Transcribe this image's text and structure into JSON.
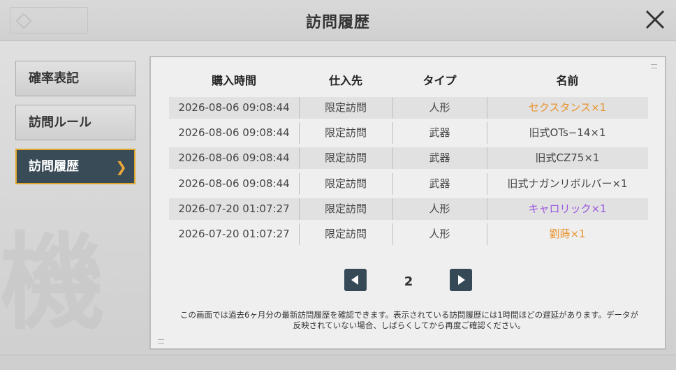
{
  "header": {
    "title": "訪問履歴"
  },
  "sidebar": {
    "items": [
      {
        "label": "確率表記"
      },
      {
        "label": "訪問ルール"
      },
      {
        "label": "訪問履歴"
      }
    ]
  },
  "table": {
    "headers": [
      "購入時間",
      "仕入先",
      "タイプ",
      "名前"
    ],
    "rows": [
      {
        "time": "2026-08-06 09:08:44",
        "source": "限定訪問",
        "type": "人形",
        "name": "セクスタンス×1",
        "color": "#e8932e"
      },
      {
        "time": "2026-08-06 09:08:44",
        "source": "限定訪問",
        "type": "武器",
        "name": "旧式OTs−14×1",
        "color": "#444444"
      },
      {
        "time": "2026-08-06 09:08:44",
        "source": "限定訪問",
        "type": "武器",
        "name": "旧式CZ75×1",
        "color": "#444444"
      },
      {
        "time": "2026-08-06 09:08:44",
        "source": "限定訪問",
        "type": "武器",
        "name": "旧式ナガンリボルバー×1",
        "color": "#444444"
      },
      {
        "time": "2026-07-20 01:07:27",
        "source": "限定訪問",
        "type": "人形",
        "name": "キャロリック×1",
        "color": "#9b55e0"
      },
      {
        "time": "2026-07-20 01:07:27",
        "source": "限定訪問",
        "type": "人形",
        "name": "劉蒔×1",
        "color": "#e8932e"
      }
    ]
  },
  "pager": {
    "page": "2"
  },
  "notice": {
    "line1": "この画面では過去6ヶ月分の最新訪問履歴を確認できます。表示されている訪問履歴には1時間ほどの遅延があります。データが",
    "line2": "反映されていない場合、しばらくしてから再度ご確認ください。"
  },
  "decor": {
    "watermark": "機"
  },
  "colors": {
    "accent": "#e0a52b",
    "active_bg": "#394b57",
    "pager_bg": "#354956"
  }
}
